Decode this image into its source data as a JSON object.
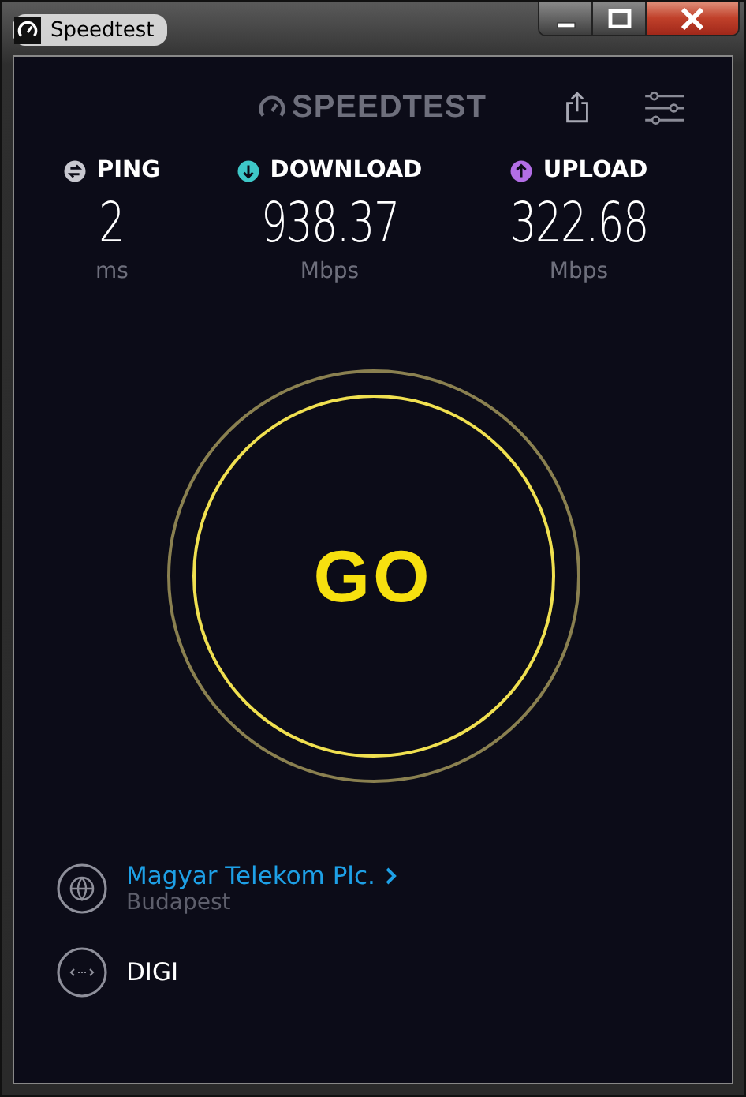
{
  "window": {
    "title": "Speedtest"
  },
  "header": {
    "logo": "SPEEDTEST"
  },
  "metrics": [
    {
      "kind": "ping",
      "label": "PING",
      "value": "2",
      "unit": "ms",
      "color": "#c8c8d0"
    },
    {
      "kind": "download",
      "label": "DOWNLOAD",
      "value": "938.37",
      "unit": "Mbps",
      "color": "#3ec8c8"
    },
    {
      "kind": "upload",
      "label": "UPLOAD",
      "value": "322.68",
      "unit": "Mbps",
      "color": "#b36ee6"
    }
  ],
  "go_button": {
    "label": "GO"
  },
  "server": {
    "name": "Magyar Telekom Plc.",
    "location": "Budapest"
  },
  "provider": {
    "name": "DIGI"
  }
}
